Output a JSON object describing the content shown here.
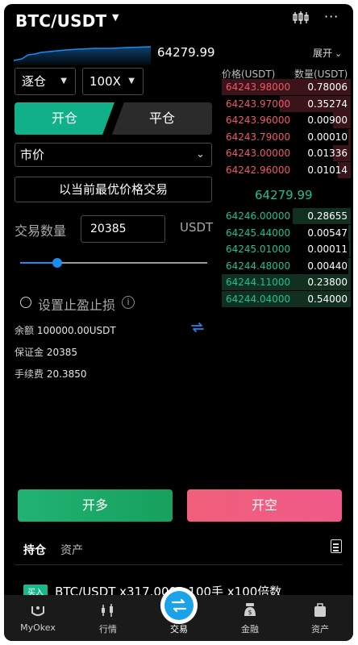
{
  "header": {
    "pair": "BTC/USDT",
    "caret": "▼",
    "more": "···"
  },
  "mini_chart": {
    "price": "64279.99"
  },
  "form": {
    "margin_mode": "逐仓",
    "leverage": "100X",
    "tab_open": "开仓",
    "tab_close": "平仓",
    "order_type": "市价",
    "best_price_btn": "以当前最优价格交易",
    "qty_label": "交易数量",
    "qty_value": "20385",
    "qty_unit": "USDT",
    "slider_fraction": 0.2,
    "tpsl_label": "设置止盈止损",
    "info_glyph": "i"
  },
  "account": {
    "balance_label": "余额",
    "balance_value": "100000.00USDT",
    "margin_label": "保证金",
    "margin_value": "20385",
    "fee_label": "手续费",
    "fee_value": "20.3850"
  },
  "orderbook": {
    "expand": "展开",
    "price_head": "价格(USDT)",
    "qty_head": "数量(USDT)",
    "asks": [
      {
        "price": "64243.98000",
        "qty": "0.78006",
        "depth": 1.0
      },
      {
        "price": "64243.97000",
        "qty": "0.35274",
        "depth": 0.55
      },
      {
        "price": "64243.96000",
        "qty": "0.00900",
        "depth": 0.14
      },
      {
        "price": "64243.79000",
        "qty": "0.00010",
        "depth": 0.02
      },
      {
        "price": "64243.00000",
        "qty": "0.01336",
        "depth": 0.14
      },
      {
        "price": "64242.96000",
        "qty": "0.01014",
        "depth": 0.1
      }
    ],
    "mid_price": "64279.99",
    "bids": [
      {
        "price": "64246.00000",
        "qty": "0.28655",
        "depth": 0.45
      },
      {
        "price": "64245.44000",
        "qty": "0.00547",
        "depth": 0.02
      },
      {
        "price": "64245.01000",
        "qty": "0.00011",
        "depth": 0.01
      },
      {
        "price": "64244.48000",
        "qty": "0.00440",
        "depth": 0.02
      },
      {
        "price": "64244.11000",
        "qty": "0.23800",
        "depth": 1.0
      },
      {
        "price": "64244.04000",
        "qty": "0.54000",
        "depth": 1.0
      }
    ]
  },
  "actions": {
    "long": "开多",
    "short": "开空"
  },
  "positions": {
    "tab_active": "持仓",
    "tab_inactive": "资产",
    "row_tag": "买入",
    "row_text": "BTC/USDT x317.0000 100手 x100倍数"
  },
  "nav": {
    "items": [
      {
        "label": "MyOkex",
        "icon": "myokex-icon"
      },
      {
        "label": "行情",
        "icon": "market-icon"
      },
      {
        "label": "交易",
        "icon": "trade-icon"
      },
      {
        "label": "金融",
        "icon": "finance-icon"
      },
      {
        "label": "资产",
        "icon": "assets-icon"
      }
    ]
  },
  "colors": {
    "accent_green": "#10b088",
    "ask_red": "#f0576a",
    "bid_green": "#19c295",
    "blue": "#1a8cf0"
  }
}
